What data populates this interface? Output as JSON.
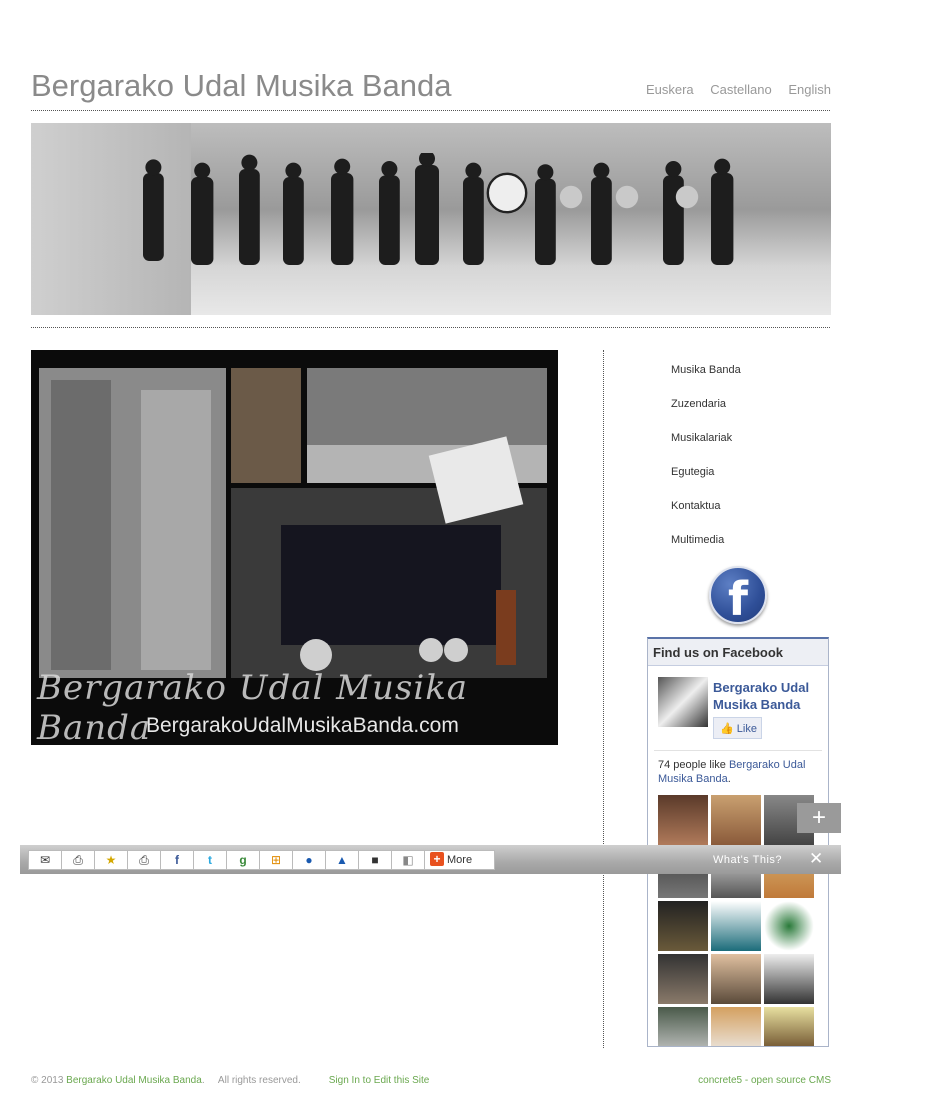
{
  "site": {
    "title": "Bergarako Udal Musika Banda"
  },
  "languages": [
    "Euskera",
    "Castellano",
    "English"
  ],
  "main_image": {
    "watermark_title": "Bergarako Udal Musika Banda",
    "watermark_url": "BergarakoUdalMusikaBanda.com"
  },
  "sidebar_nav": [
    "Musika Banda",
    "Zuzendaria",
    "Musikalariak",
    "Egutegia",
    "Kontaktua",
    "Multimedia"
  ],
  "facebook": {
    "logo_glyph": "f",
    "box_title": "Find us on Facebook",
    "page_name": "Bergarako Udal Musika Banda",
    "like_label": "Like",
    "count_text": "74 people like ",
    "count_link": "Bergarako Udal Musika Banda",
    "count_suffix": "."
  },
  "share_bar": {
    "icons": [
      "email-icon",
      "email-app-icon",
      "favorites-icon",
      "print-icon",
      "facebook-icon",
      "twitter-icon",
      "google-icon",
      "windows-live-icon",
      "myspace-icon",
      "aim-icon",
      "delicious-icon",
      "digg-icon"
    ],
    "more_label": "More",
    "whats_this": "What's This?",
    "close": "✕",
    "expand": "+"
  },
  "footer": {
    "copyright_prefix": "© 2013 ",
    "site_link": "Bergarako Udal Musika Banda",
    "rights": ".     All rights reserved.",
    "sign_in": "Sign In to Edit this Site",
    "cms": "concrete5 - open source CMS"
  }
}
